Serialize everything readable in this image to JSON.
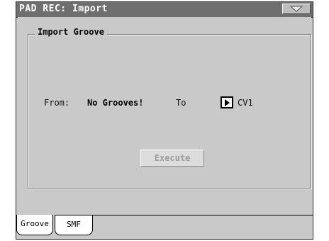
{
  "window": {
    "title": "PAD REC: Import"
  },
  "section": {
    "title": "Import Groove"
  },
  "form": {
    "from_label": "From:",
    "from_value": "No Grooves!",
    "to_label": "To",
    "to_value": "CV1"
  },
  "actions": {
    "execute_label": "Execute",
    "execute_enabled": false
  },
  "tabs": [
    {
      "label": "Groove",
      "active": true
    },
    {
      "label": "SMF",
      "active": false
    }
  ],
  "icons": {
    "menu": "menu-triangle-icon",
    "to_selector": "play-triangle-icon"
  },
  "colors": {
    "titlebar": "#6f6f6f",
    "background": "#c9c9c9",
    "disabled_text": "#9c9c9c"
  }
}
